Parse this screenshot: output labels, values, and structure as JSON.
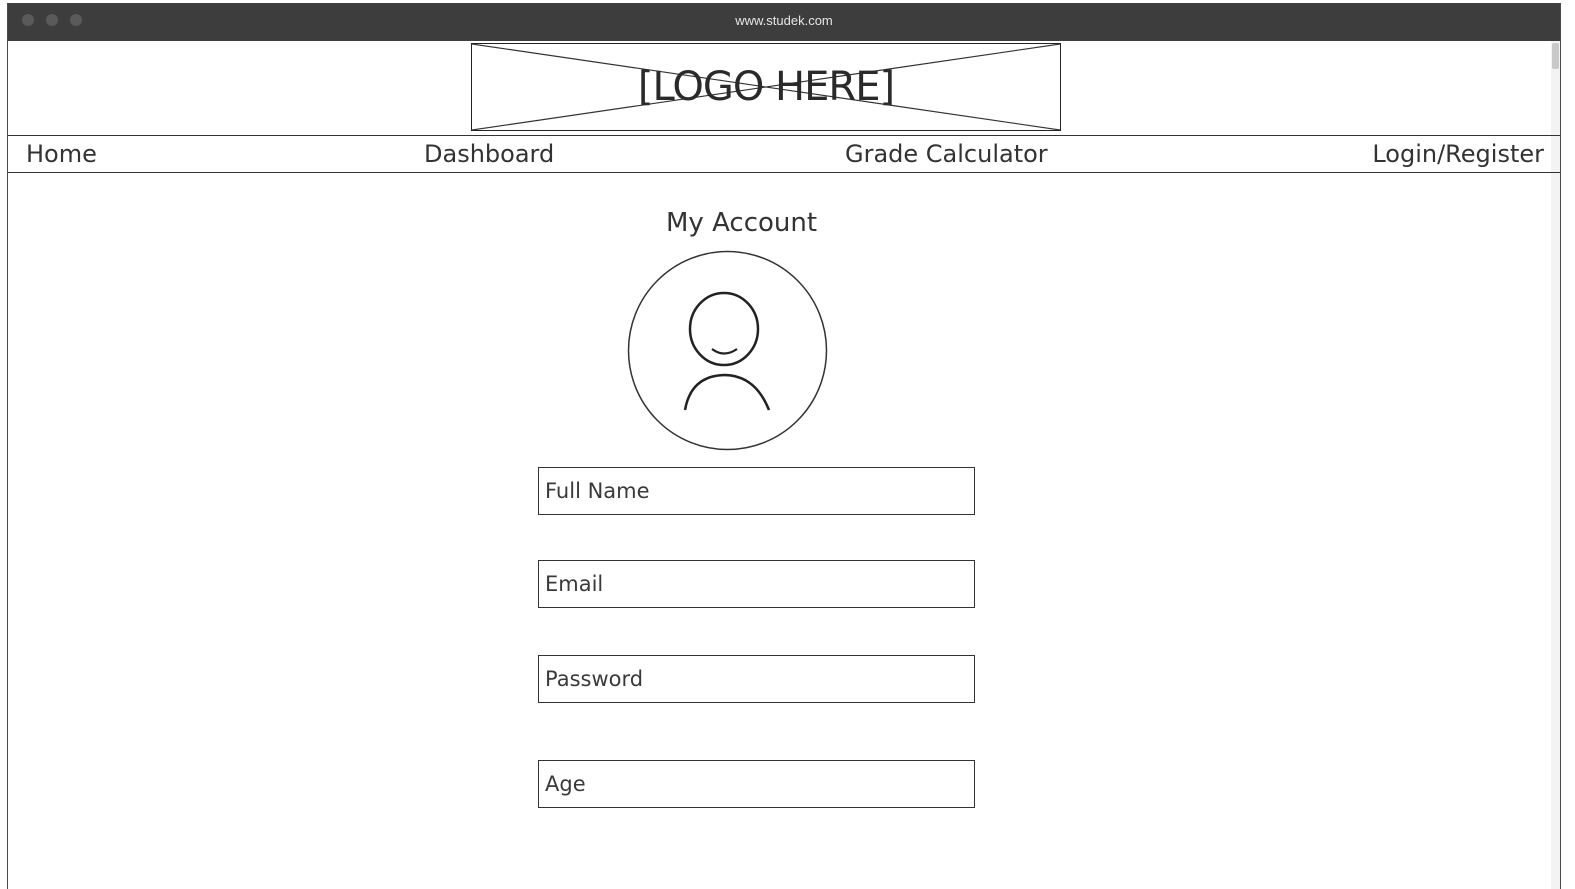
{
  "window": {
    "url": "www.studek.com"
  },
  "header": {
    "logo_text": "[LOGO HERE]"
  },
  "nav": {
    "home": "Home",
    "dashboard": "Dashboard",
    "grade_calculator": "Grade Calculator",
    "login_register": "Login/Register"
  },
  "main": {
    "title": "My Account",
    "avatar_icon": "user-avatar-icon",
    "fields": {
      "full_name": {
        "placeholder": "Full Name",
        "value": ""
      },
      "email": {
        "placeholder": "Email",
        "value": ""
      },
      "password": {
        "placeholder": "Password",
        "value": ""
      },
      "age": {
        "placeholder": "Age",
        "value": ""
      }
    }
  }
}
